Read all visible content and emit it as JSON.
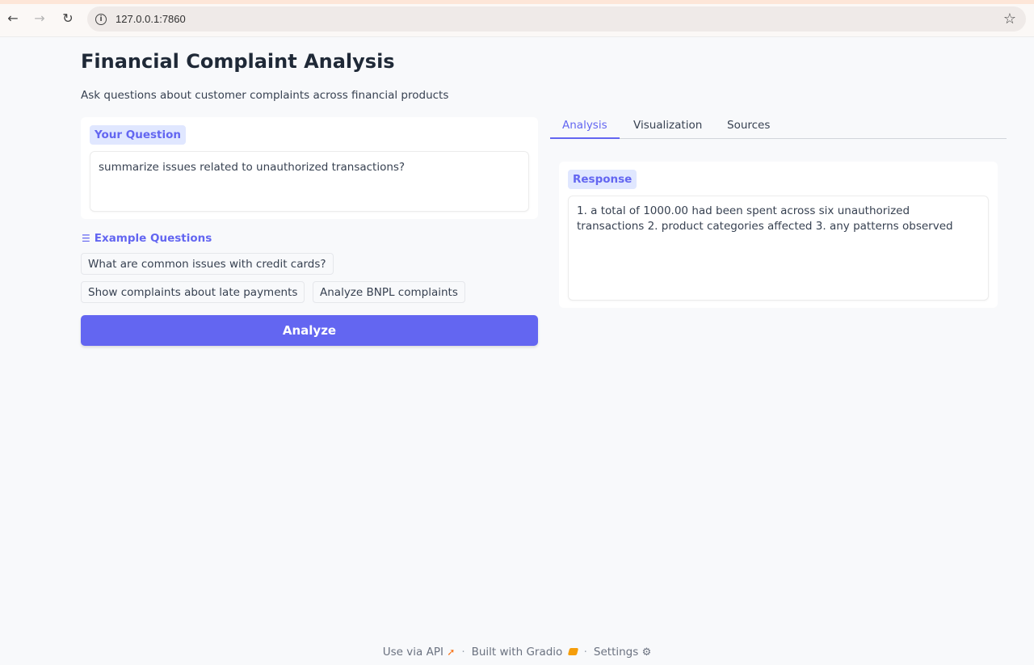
{
  "browser": {
    "url": "127.0.0.1:7860",
    "icons": {
      "back": "back-arrow-icon",
      "forward": "forward-arrow-icon",
      "reload": "reload-icon",
      "info": "info-icon",
      "bookmark": "star-icon"
    }
  },
  "header": {
    "title": "Financial Complaint Analysis",
    "subtitle": "Ask questions about customer complaints across financial products"
  },
  "question": {
    "label": "Your Question",
    "value": "summarize issues related to unauthorized transactions?"
  },
  "examples": {
    "header": "Example Questions",
    "items": [
      "What are common issues with credit cards?",
      "Show complaints about late payments",
      "Analyze BNPL complaints"
    ]
  },
  "actions": {
    "analyze_label": "Analyze"
  },
  "tabs": [
    {
      "label": "Analysis",
      "active": true
    },
    {
      "label": "Visualization",
      "active": false
    },
    {
      "label": "Sources",
      "active": false
    }
  ],
  "response": {
    "label": "Response",
    "text": "1. a total of 1000.00 had been spent across six unauthorized transactions 2. product categories affected 3. any patterns observed"
  },
  "footer": {
    "api": "Use via API",
    "built": "Built with Gradio",
    "settings": "Settings"
  },
  "colors": {
    "accent": "#6366f1",
    "label_bg": "#e0e7ff",
    "page_bg": "#f8f9fb"
  }
}
